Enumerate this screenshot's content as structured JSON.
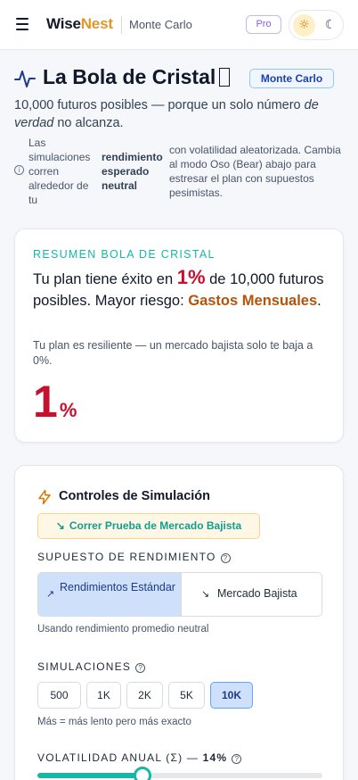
{
  "app": {
    "brand_part1": "Wise",
    "brand_part2": "Nest",
    "breadcrumb": "Monte Carlo",
    "pro_badge": "Pro",
    "icons": {
      "menu": "hamburger-icon",
      "light": "sun-icon",
      "dark": "moon-icon"
    }
  },
  "page": {
    "title": "La Bola de Cristal",
    "mode_badge": "Monte Carlo",
    "subtitle_part1": "10,000 futuros posibles — porque un solo número ",
    "subtitle_emph": "de verdad",
    "subtitle_part2": " no alcanza.",
    "info_part1": "Las simulaciones corren alrededor de tu",
    "info_bold": "rendimiento esperado neutral",
    "info_part2": "con volatilidad aleatorizada. Cambia al modo Oso (Bear) abajo para estresar el plan con supuestos pesimistas."
  },
  "summary": {
    "kicker": "RESUMEN BOLA DE CRISTAL",
    "headline_part1": "Tu plan tiene éxito en ",
    "headline_pct": "1%",
    "headline_part2": " de 10,000 futuros posibles. Mayor riesgo: ",
    "headline_risk": "Gastos Mensuales",
    "headline_end": ".",
    "note": "Tu plan es resiliente — un mercado bajista solo te baja a 0%.",
    "success_value": "1",
    "success_unit": "%"
  },
  "controls": {
    "title": "Controles de Simulación",
    "stress_button": "Correr Prueba de Mercado Bajista",
    "return_label": "SUPUESTO DE RENDIMIENTO",
    "return_options": [
      {
        "label": "Rendimientos Estándar",
        "selected": true
      },
      {
        "label": "Mercado Bajista",
        "selected": false
      }
    ],
    "return_hint": "Usando rendimiento promedio neutral",
    "sims_label": "SIMULACIONES",
    "sims_options": [
      {
        "label": "500",
        "selected": false
      },
      {
        "label": "1K",
        "selected": false
      },
      {
        "label": "2K",
        "selected": false
      },
      {
        "label": "5K",
        "selected": false
      },
      {
        "label": "10K",
        "selected": true
      }
    ],
    "sims_hint": "Más = más lento pero más exacto",
    "vol_label": "VOLATILIDAD ANUAL (Σ) — ",
    "vol_value": "14%",
    "vol_slider_fraction": 0.37
  },
  "colors": {
    "accent_teal": "#14b8a6",
    "danger_red": "#c8102e",
    "risk_orange": "#b45309",
    "brand_orange": "#e0972a",
    "selected_blue": "#cfe0fb"
  }
}
